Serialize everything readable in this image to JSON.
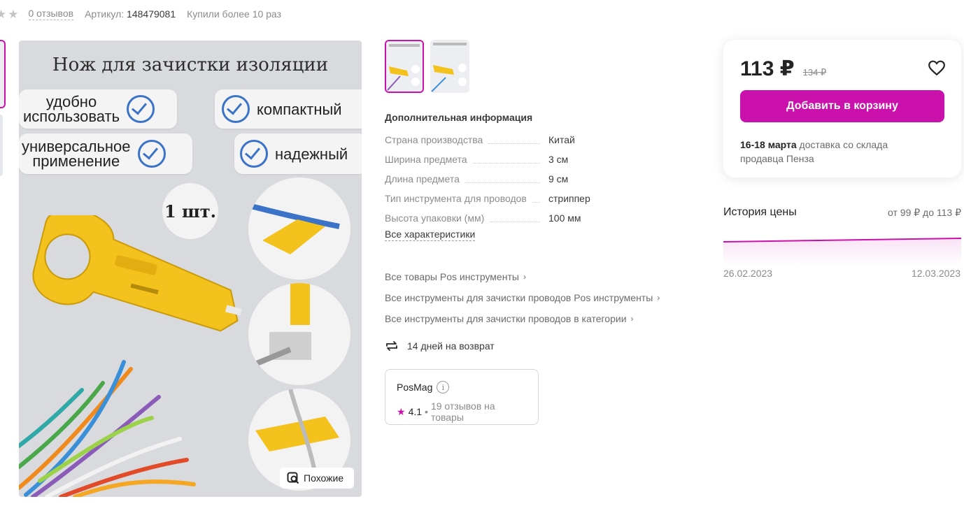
{
  "meta": {
    "reviews": "0 отзывов",
    "article_label": "Артикул:",
    "article_value": "148479081",
    "bought": "Купили более 10 раз"
  },
  "image": {
    "title": "Нож для зачистки изоляции",
    "badge1": "удобно\nиспользовать",
    "badge2": "компактный",
    "badge3": "универсальное\nприменение",
    "badge4": "надежный",
    "qty": "1 шт.",
    "similar": "Похожие"
  },
  "info": {
    "title": "Дополнительная информация",
    "specs": [
      {
        "k": "Страна производства",
        "v": "Китай"
      },
      {
        "k": "Ширина предмета",
        "v": "3 см"
      },
      {
        "k": "Длина предмета",
        "v": "9 см"
      },
      {
        "k": "Тип инструмента для проводов",
        "v": "стриппер"
      },
      {
        "k": "Высота упаковки (мм)",
        "v": "100 мм"
      }
    ],
    "all_chars": "Все характеристики",
    "links": [
      "Все товары Pos инструменты",
      "Все инструменты для зачистки проводов Pos инструменты",
      "Все инструменты для зачистки проводов в категории"
    ],
    "return": "14 дней на возврат"
  },
  "seller": {
    "name": "PosMag",
    "rating": "4.1",
    "reviews": "19 отзывов на товары"
  },
  "card": {
    "price": "113 ₽",
    "old_price": "134 ₽",
    "button": "Добавить в корзину",
    "delivery_date": "16-18 марта",
    "delivery_text": " доставка со склада продавца Пенза"
  },
  "history": {
    "title": "История цены",
    "range": "от 99 ₽ до 113 ₽",
    "date_start": "26.02.2023",
    "date_end": "12.03.2023"
  },
  "colors": {
    "accent": "#cb11ab",
    "check_blue": "#3a73c7",
    "tool_yellow": "#f4c21c"
  },
  "icons": [
    "star-icon",
    "heart-icon",
    "return-icon",
    "info-icon",
    "search-similar-icon",
    "chevron-right-icon",
    "check-icon"
  ]
}
